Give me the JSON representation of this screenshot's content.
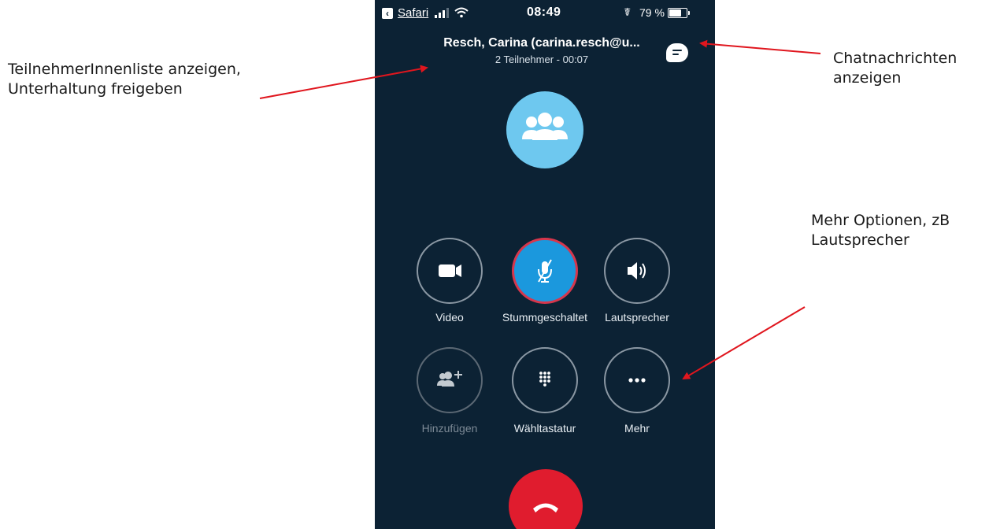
{
  "annotations": {
    "participants": [
      "TeilnehmerInnenliste  anzeigen,",
      "Unterhaltung freigeben"
    ],
    "chat": [
      "Chatnachrichten",
      "anzeigen"
    ],
    "more": [
      "Mehr Optionen, zB",
      "Lautsprecher"
    ]
  },
  "statusbar": {
    "back_app": "Safari",
    "time": "08:49",
    "battery_text": "79 %",
    "battery_level": 0.79
  },
  "call": {
    "title": "Resch, Carina (carina.resch@u...",
    "subtitle": "2 Teilnehmer - 00:07"
  },
  "controls": {
    "video": "Video",
    "mute": "Stummgeschaltet",
    "speaker": "Lautsprecher",
    "add": "Hinzufügen",
    "dialpad": "Wähltastatur",
    "more": "Mehr"
  },
  "icons": {
    "back": "chevron-left-icon",
    "signal": "signal-icon",
    "wifi": "wifi-icon",
    "rotation_lock": "rotation-lock-icon",
    "battery": "battery-icon",
    "chat": "chat-bubble-icon",
    "avatar": "group-icon",
    "video": "video-camera-icon",
    "mute": "microphone-muted-icon",
    "speaker": "speaker-icon",
    "add": "add-person-icon",
    "dialpad": "dialpad-icon",
    "more": "more-dots-icon",
    "hangup": "hangup-icon"
  },
  "colors": {
    "background": "#0c2234",
    "avatar": "#6ec8ef",
    "mute_active": "#1b98dd",
    "mute_border": "#d6364c",
    "hangup": "#e01c2e",
    "arrow": "#e0161e"
  }
}
